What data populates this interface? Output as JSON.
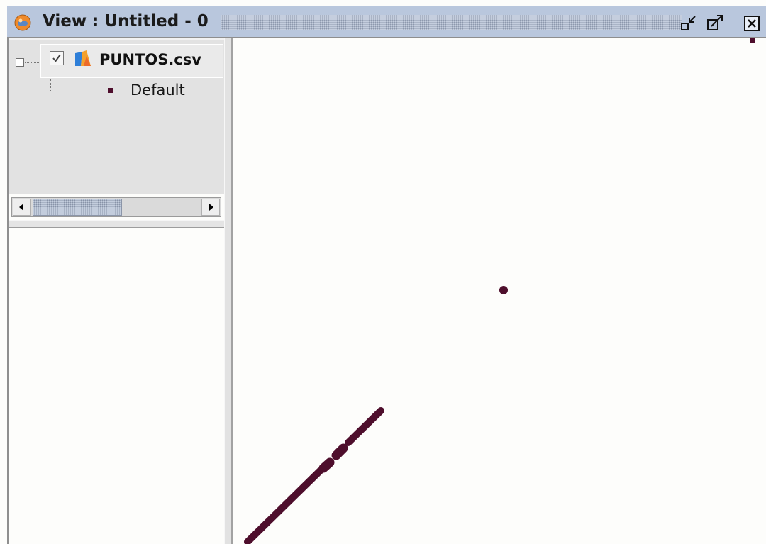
{
  "window": {
    "title": "View : Untitled - 0",
    "app_icon": "gvsig-globe-icon",
    "buttons": [
      "minimize-icon",
      "maximize-icon",
      "close-icon"
    ]
  },
  "toc": {
    "layer": {
      "name": "PUNTOS.csv",
      "visible": true,
      "icon": "vector-layer-icon",
      "legend": [
        {
          "label": "Default",
          "symbol_color": "#4e0e2c"
        }
      ]
    }
  },
  "map": {
    "point_color": "#4e0e2c",
    "background": "#fdfdfb"
  }
}
